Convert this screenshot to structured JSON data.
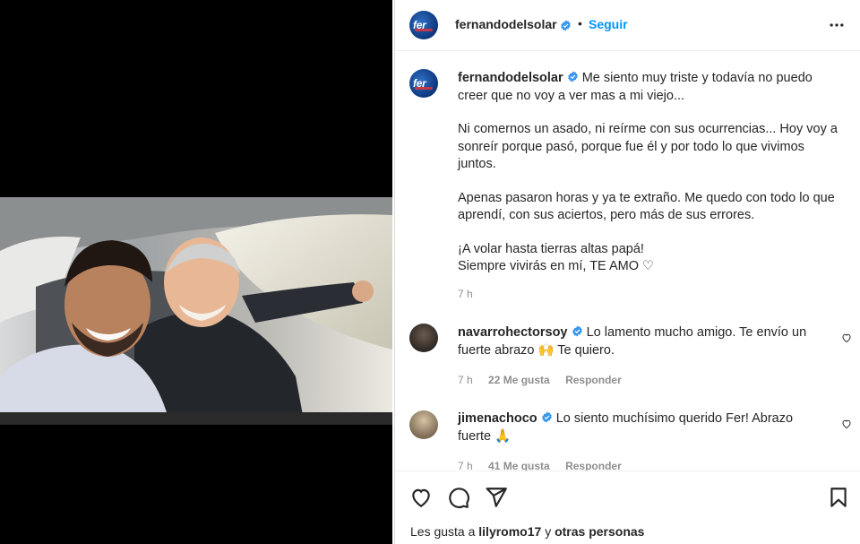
{
  "post": {
    "author": "fernandodelsolar",
    "separator": "•",
    "follow_label": "Seguir",
    "avatar_text": "fer"
  },
  "caption": {
    "username": "fernandodelsolar",
    "p1": "Me siento muy triste y todavía no puedo creer que no voy a ver mas a mi viejo...",
    "p2": "Ni comernos un asado, ni reírme con sus ocurrencias... Hoy voy a sonreír porque pasó, porque fue él y por todo lo que vivimos juntos.",
    "p3": "Apenas pasaron horas y ya te extraño. Me quedo con todo lo que aprendí, con sus aciertos, pero más de sus errores.",
    "p4a": "¡A volar hasta tierras altas papá!",
    "p4b": "Siempre vivirás en mí, TE AMO ♡",
    "time": "7 h"
  },
  "comments": [
    {
      "username": "navarrohectorsoy",
      "text": "Lo lamento mucho amigo. Te envío un fuerte abrazo 🙌 Te quiero.",
      "time": "7 h",
      "likes": "22 Me gusta",
      "reply": "Responder"
    },
    {
      "username": "jimenachoco",
      "text": "Lo siento muchísimo querido Fer! Abrazo fuerte 🙏",
      "time": "7 h",
      "likes": "41 Me gusta",
      "reply": "Responder"
    }
  ],
  "footer": {
    "likes_prefix": "Les gusta a",
    "likes_user": "lilyromo17",
    "likes_conj": "y",
    "likes_others": "otras personas"
  },
  "icons": {
    "like": "heart-icon",
    "comment": "comment-icon",
    "share": "share-icon",
    "save": "bookmark-icon",
    "more": "more-icon",
    "verified": "verified-badge-icon"
  },
  "colors": {
    "accent": "#0095f6",
    "verified": "#3897f0",
    "muted": "#8e8e8e"
  }
}
